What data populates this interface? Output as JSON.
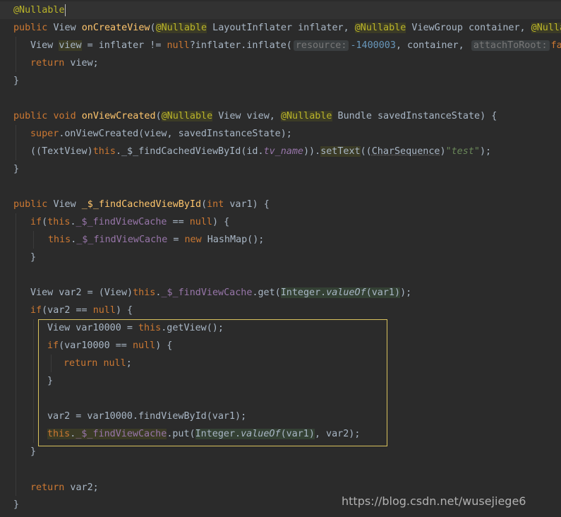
{
  "code": {
    "annotation_nullable": "@Nullable",
    "public": "public",
    "void": "void",
    "int": "int",
    "return": "return",
    "null": "null",
    "new": "new",
    "super": "super",
    "this": "this",
    "if": "if",
    "View": "View",
    "onCreateView": "onCreateView",
    "onViewCreated": "onViewCreated",
    "findCachedViewById": "_$_findCachedViewById",
    "findViewCache": "_$_findViewCache",
    "LayoutInflater": " LayoutInflater inflater, ",
    "ViewGroup": " ViewGroup container, ",
    "view_var": "view",
    "inflater_expr": " = inflater != ",
    "inflate_call": "?inflater.inflate(",
    "hint_resource": "resource:",
    "resource_value": "-1400003",
    "container_arg": ", container, ",
    "hint_attach": "attachToRoot:",
    "attach_value": "false",
    "return_view": " view;",
    "brace_close": "}",
    "view_param": " View view, ",
    "bundle_param": " Bundle savedInstanceState) {",
    "super_call": ".onViewCreated(view, savedInstanceState);",
    "textview_cast": "((TextView)",
    "id_arg": "(id.",
    "tv_name": "tv_name",
    "settext_open": ")).",
    "setText": "setText",
    "charseq_open": "((",
    "CharSequence": "CharSequence",
    "str_test": "\"test\"",
    "find_sig": "(int var1) {",
    "eq_null": " == ",
    "hashmap_expr": " HashMap();",
    "var2_decl": "View var2 = (View)",
    "get_call": ".get(",
    "Integer": "Integer.",
    "valueOf": "valueOf",
    "var1_close": "(var1)",
    "var2_if": "(var2 == ",
    "var10000_decl": "View var10000 = ",
    "getView": ".getView();",
    "var10000_if": "(var10000 == ",
    "var2_assign": "var2 = var10000.findViewById(var1);",
    "put_call": ".put(",
    "put_tail": ", var2);",
    "return_var2": " var2;"
  },
  "watermark": "https://blog.csdn.net/wusejiege6"
}
